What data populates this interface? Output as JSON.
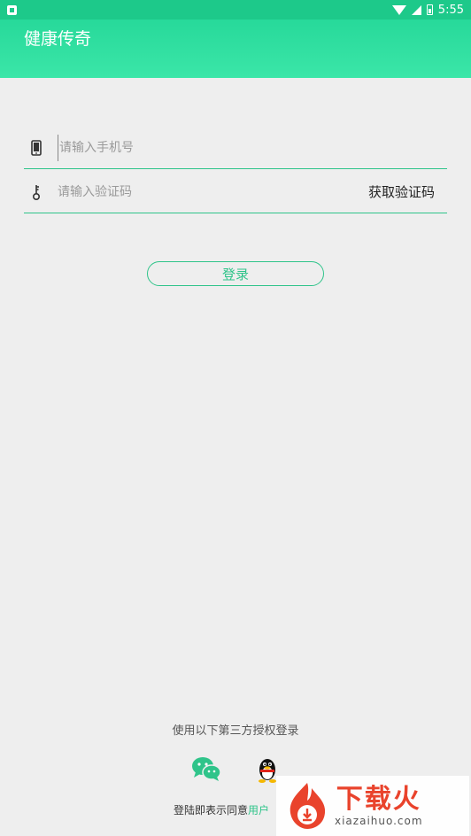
{
  "status_bar": {
    "time": "5:55"
  },
  "app_bar": {
    "title": "健康传奇"
  },
  "login_form": {
    "phone_placeholder": "请输入手机号",
    "code_placeholder": "请输入验证码",
    "get_code_label": "获取验证码",
    "login_label": "登录"
  },
  "third_party": {
    "label": "使用以下第三方授权登录",
    "options": [
      "wechat-icon",
      "qq-icon"
    ]
  },
  "agreement": {
    "prefix": "登陆即表示同意",
    "link": "用户"
  },
  "watermark": {
    "title": "下载火",
    "subtitle": "xiazaihuo.com"
  },
  "colors": {
    "accent": "#2fc48a",
    "app_bar_top": "#27d99a",
    "background": "#eeeeee",
    "watermark_red": "#e9432c"
  }
}
